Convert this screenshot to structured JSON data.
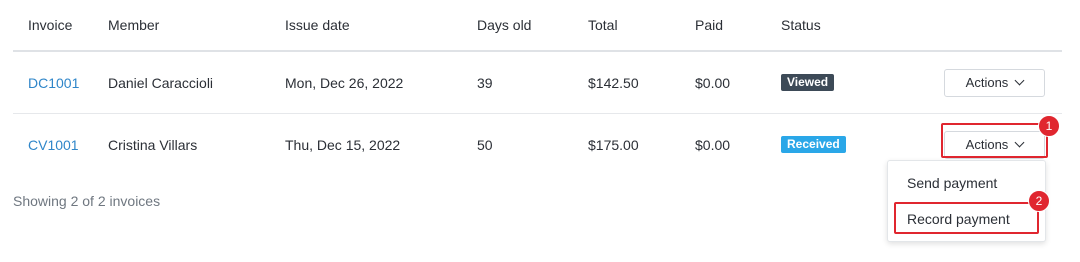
{
  "columns": {
    "invoice": "Invoice",
    "member": "Member",
    "issue_date": "Issue date",
    "days_old": "Days old",
    "total": "Total",
    "paid": "Paid",
    "status": "Status"
  },
  "rows": [
    {
      "invoice": "DC1001",
      "member": "Daniel Caraccioli",
      "issue_date": "Mon, Dec 26, 2022",
      "days_old": "39",
      "total": "$142.50",
      "paid": "$0.00",
      "status": "Viewed",
      "action": "Actions"
    },
    {
      "invoice": "CV1001",
      "member": "Cristina Villars",
      "issue_date": "Thu, Dec 15, 2022",
      "days_old": "50",
      "total": "$175.00",
      "paid": "$0.00",
      "status": "Received",
      "action": "Actions"
    }
  ],
  "footer": "Showing 2 of 2 invoices",
  "menu": {
    "items": [
      "Send payment",
      "Record payment"
    ]
  },
  "markers": [
    "1",
    "2"
  ],
  "colors": {
    "link": "#2f86c9",
    "viewed": "#3d4a57",
    "received": "#2aa7e8",
    "highlight": "#e0262f"
  },
  "icons": {
    "dropdown": "chevron-down-icon"
  }
}
